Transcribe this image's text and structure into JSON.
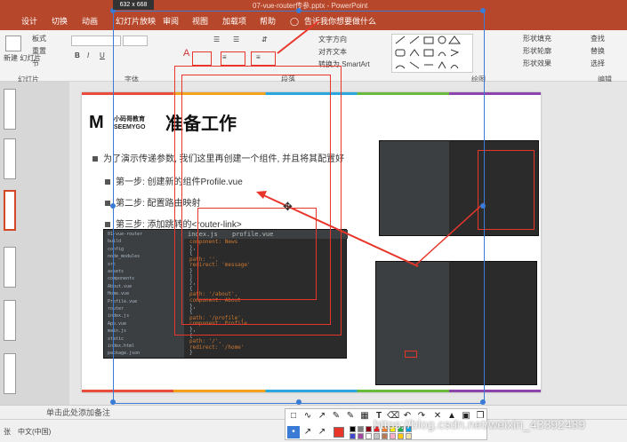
{
  "window": {
    "title": "07-vue-router传参.pptx - PowerPoint",
    "selection_size": "632 x 668"
  },
  "tabs": [
    "设计",
    "切换",
    "动画",
    "幻灯片放映",
    "审阅",
    "视图",
    "加载项",
    "帮助"
  ],
  "tell_me": "告诉我你想要做什么",
  "ribbon": {
    "new_slide": "新建\n幻灯片",
    "layout": "板式",
    "reset": "重置",
    "section": "节",
    "text_direction": "文字方向",
    "align_text": "对齐文本",
    "smartart": "转换为 SmartArt",
    "shape_fill": "形状填充",
    "shape_outline": "形状轮廓",
    "shape_effect": "形状效果",
    "find": "查找",
    "replace": "替换",
    "select": "选择",
    "groups": {
      "slides": "幻灯片",
      "font": "字体",
      "paragraph": "段落",
      "drawing": "绘图",
      "editing": "编辑"
    }
  },
  "slide": {
    "logo_cn": "小码哥教育",
    "logo_en": "SEEMYGO",
    "title": "准备工作",
    "intro": "为了演示传递参数, 我们这里再创建一个组件, 并且将其配置好",
    "steps": [
      "第一步: 创建新的组件Profile.vue",
      "第二步: 配置路由映射",
      "第三步: 添加跳转的<router-link>"
    ]
  },
  "code_main": {
    "tab1": "index.js",
    "tab2": "profile.vue",
    "lines": [
      {
        "n": "",
        "t": "component: News"
      },
      {
        "n": "",
        "t": "},"
      },
      {
        "n": "",
        "t": "{"
      },
      {
        "n": "",
        "t": "  path: '',"
      },
      {
        "n": "",
        "t": "  redirect: 'message'"
      },
      {
        "n": "",
        "t": "}"
      },
      {
        "n": "",
        "t": "]"
      },
      {
        "n": "",
        "t": "},"
      },
      {
        "n": "",
        "t": "{"
      },
      {
        "n": "",
        "t": "  path: '/about',"
      },
      {
        "n": "",
        "t": "  component: About"
      },
      {
        "n": "",
        "t": "},"
      },
      {
        "n": "",
        "t": "{"
      },
      {
        "n": "",
        "t": "  path: '/profile',"
      },
      {
        "n": "",
        "t": "  component: Profile"
      },
      {
        "n": "",
        "t": "},"
      },
      {
        "n": "",
        "t": "{"
      },
      {
        "n": "",
        "t": "  path: '/',"
      },
      {
        "n": "",
        "t": "  redirect: '/home'"
      },
      {
        "n": "",
        "t": "}"
      }
    ]
  },
  "code_tree": [
    "01-vue-router",
    "build",
    "config",
    "node_modules",
    "src",
    "assets",
    "components",
    "About.vue",
    "Home.vue",
    "Profile.vue",
    "router",
    "index.js",
    "App.vue",
    "main.js",
    "static",
    "index.html",
    "package.json"
  ],
  "notes_placeholder": "单击此处添加备注",
  "status": {
    "lang": "中文(中国)",
    "slide_no": "张"
  },
  "watermark": "https://blog.csdn.net/weixin_43392489",
  "colors": {
    "accent": "#b7472a",
    "selection": "#3a7bd5",
    "annotation": "#e8362b"
  }
}
